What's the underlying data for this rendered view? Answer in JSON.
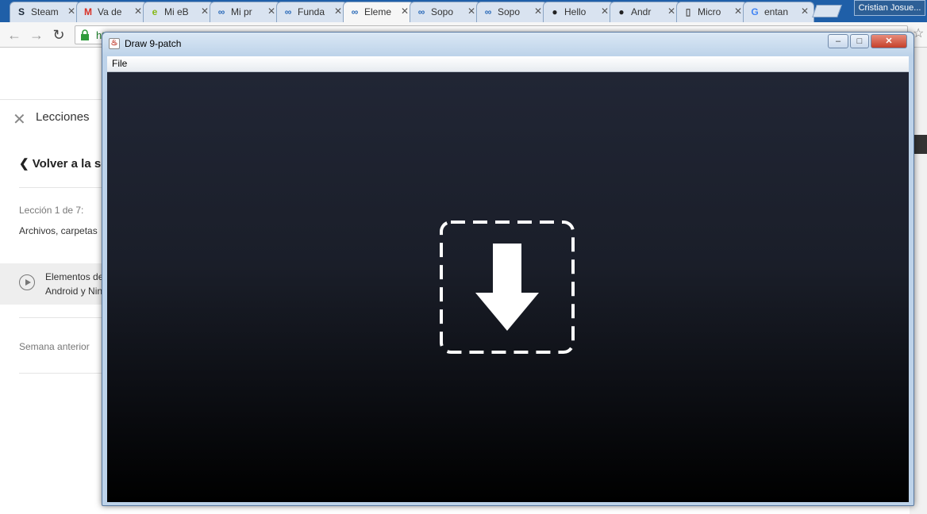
{
  "browser": {
    "tabs": [
      {
        "label": "Steam",
        "icon": "steam-icon",
        "active": false
      },
      {
        "label": "Va de",
        "icon": "gmail-icon",
        "active": false
      },
      {
        "label": "Mi eB",
        "icon": "ebay-icon",
        "active": false
      },
      {
        "label": "Mi pr",
        "icon": "platzi-icon",
        "active": false
      },
      {
        "label": "Funda",
        "icon": "platzi-icon",
        "active": false
      },
      {
        "label": "Eleme",
        "icon": "platzi-icon",
        "active": true
      },
      {
        "label": "Sopo",
        "icon": "platzi-icon",
        "active": false
      },
      {
        "label": "Sopo",
        "icon": "platzi-icon",
        "active": false
      },
      {
        "label": "Hello",
        "icon": "github-icon",
        "active": false
      },
      {
        "label": "Andr",
        "icon": "github-icon",
        "active": false
      },
      {
        "label": "Micro",
        "icon": "document-icon",
        "active": false
      },
      {
        "label": "entan",
        "icon": "google-icon",
        "active": false
      }
    ],
    "user_name": "Cristian Josue...",
    "url_prefix": "https"
  },
  "sidebar": {
    "lessons_label": "Lecciones",
    "back_label": "Volver a la se",
    "lesson_counter": "Lección 1 de 7:",
    "lesson_topic": "Archivos, carpetas",
    "current_lesson": [
      "Elementos de",
      "Android y Nin"
    ],
    "prev_week": "Semana anterior"
  },
  "window": {
    "title": "Draw 9-patch",
    "menu_file": "File",
    "colors": {
      "canvas_top": "#212635",
      "canvas_bottom": "#000000",
      "icon": "#ffffff"
    }
  }
}
